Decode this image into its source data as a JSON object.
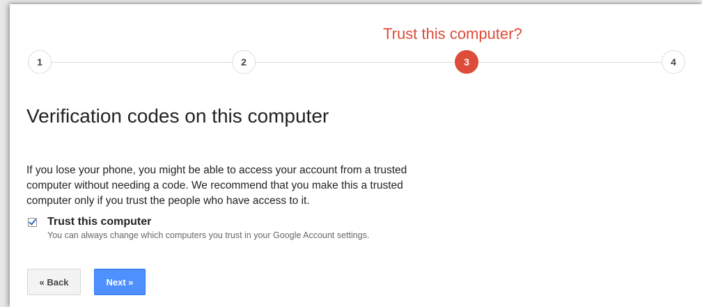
{
  "stepper": {
    "current_title": "Trust this computer?",
    "steps": [
      {
        "label": "1",
        "active": false
      },
      {
        "label": "2",
        "active": false
      },
      {
        "label": "3",
        "active": true
      },
      {
        "label": "4",
        "active": false
      }
    ]
  },
  "main": {
    "heading": "Verification codes on this computer",
    "description_lines": [
      "If you lose your phone, you might be able to access your account from a trusted",
      "computer without needing a code. We recommend that you make this a trusted",
      "computer only if you trust the people who have access to it."
    ],
    "trust_checkbox": {
      "checked": true,
      "label": "Trust this computer",
      "hint": "You can always change which computers you trust in your Google Account settings."
    }
  },
  "buttons": {
    "back_label": "« Back",
    "next_label": "Next »"
  },
  "colors": {
    "accent_red": "#dd4b39",
    "primary_blue": "#4d90fe",
    "checkmark_blue": "#3366cc"
  }
}
